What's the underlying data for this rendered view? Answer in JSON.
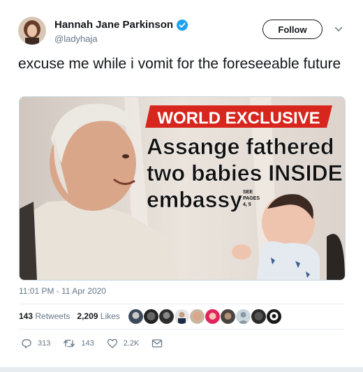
{
  "author": {
    "name": "Hannah Jane Parkinson",
    "handle": "@ladyhaja",
    "avatar": "avatar-photo",
    "verified_icon": "verified-badge-icon"
  },
  "header": {
    "follow_label": "Follow",
    "more_icon": "chevron-down-icon"
  },
  "tweet": {
    "text": "excuse me while i vomit for the foreseeable future",
    "timestamp": "11:01 PM - 11 Apr 2020"
  },
  "media": {
    "banner": "WORLD EXCLUSIVE",
    "headline_line1": "Assange fathered",
    "headline_line2": "two babies INSIDE",
    "headline_line3": "embassy",
    "see_pages_1": "SEE",
    "see_pages_2": "PAGES",
    "see_pages_3": "4, 5"
  },
  "stats": {
    "retweets_count": "143",
    "retweets_label": "Retweets",
    "likes_count": "2,209",
    "likes_label": "Likes"
  },
  "actions": {
    "reply_count": "313",
    "retweet_count": "143",
    "like_count": "2.2K"
  },
  "colors": {
    "banner_red": "#d7261e",
    "muted": "#657786",
    "verified_blue": "#1da1f2"
  }
}
